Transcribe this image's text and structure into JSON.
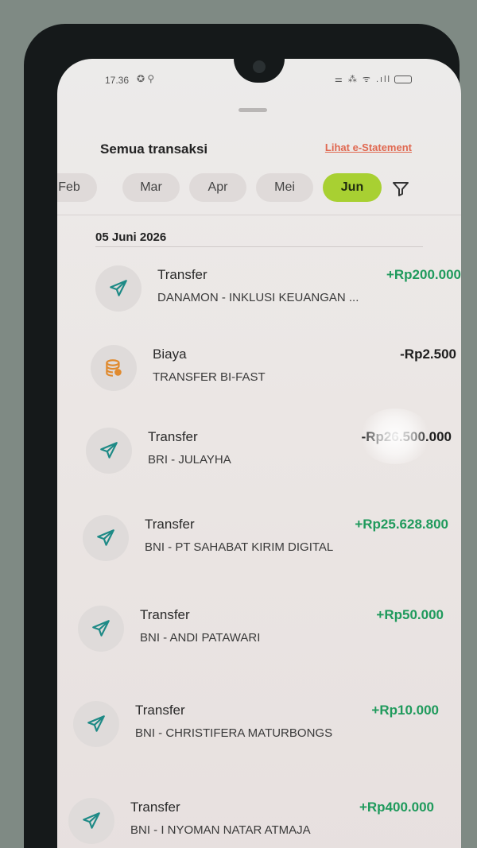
{
  "status_bar": {
    "time": "17.36",
    "left_icons": "✪ ⚲",
    "right_icons": "⚌ ⁂ ᯤ .ıll"
  },
  "header": {
    "title": "Semua transaksi",
    "statement_link": "Lihat e-Statement"
  },
  "months": [
    {
      "label": "Feb",
      "active": false
    },
    {
      "label": "Mar",
      "active": false
    },
    {
      "label": "Apr",
      "active": false
    },
    {
      "label": "Mei",
      "active": false
    },
    {
      "label": "Jun",
      "active": true
    }
  ],
  "filter_icon": "filter-icon",
  "date_heading": "05 Juni 2026",
  "transactions": [
    {
      "type": "Transfer",
      "description": "DANAMON - INKLUSI KEUANGAN ...",
      "amount": "+Rp200.000",
      "direction": "plus",
      "icon": "send-icon"
    },
    {
      "type": "Biaya",
      "description": "TRANSFER BI-FAST",
      "amount": "-Rp2.500",
      "direction": "minus",
      "icon": "coins-icon"
    },
    {
      "type": "Transfer",
      "description": "BRI - JULAYHA",
      "amount": "-Rp26.500.000",
      "direction": "minus",
      "icon": "send-icon"
    },
    {
      "type": "Transfer",
      "description": "BNI - PT SAHABAT KIRIM DIGITAL",
      "amount": "+Rp25.628.800",
      "direction": "plus",
      "icon": "send-icon"
    },
    {
      "type": "Transfer",
      "description": "BNI - ANDI PATAWARI",
      "amount": "+Rp50.000",
      "direction": "plus",
      "icon": "send-icon"
    },
    {
      "type": "Transfer",
      "description": "BNI - CHRISTIFERA MATURBONGS",
      "amount": "+Rp10.000",
      "direction": "plus",
      "icon": "send-icon"
    },
    {
      "type": "Transfer",
      "description": "BNI - I NYOMAN NATAR ATMAJA",
      "amount": "+Rp400.000",
      "direction": "plus",
      "icon": "send-icon"
    }
  ],
  "colors": {
    "credit": "#1f9a5c",
    "debit": "#1e1e1e",
    "active_chip": "#a8d032",
    "link": "#e06850",
    "icon_teal": "#1e8a86",
    "icon_orange": "#e08a2e"
  }
}
